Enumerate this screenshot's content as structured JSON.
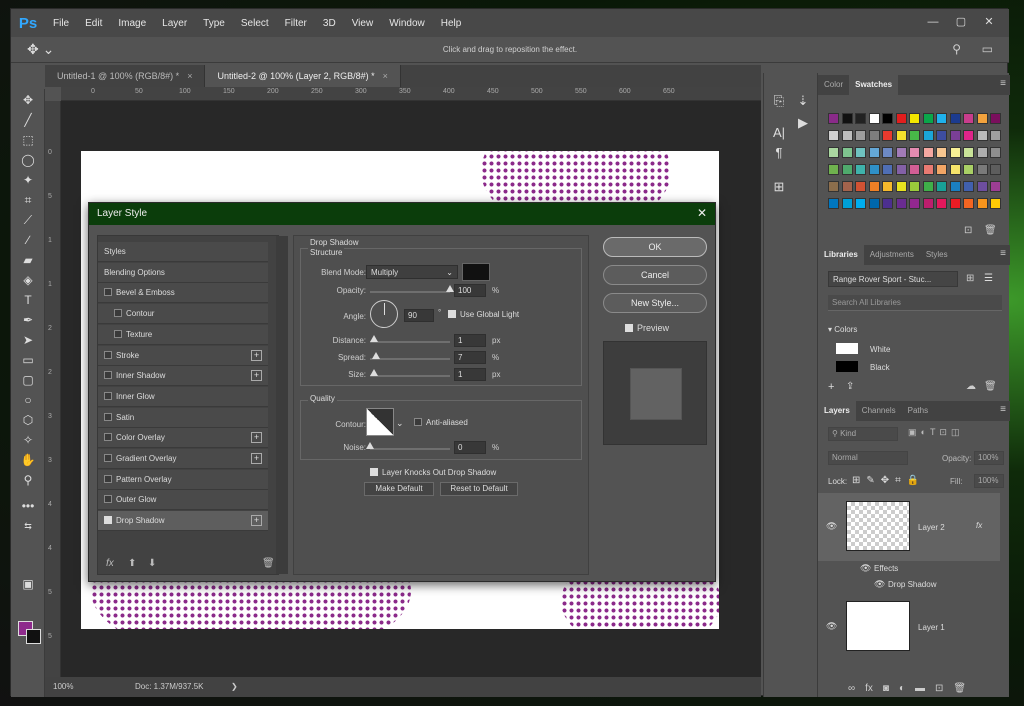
{
  "app": {
    "logo": "Ps",
    "menu": [
      "File",
      "Edit",
      "Image",
      "Layer",
      "Type",
      "Select",
      "Filter",
      "3D",
      "View",
      "Window",
      "Help"
    ],
    "window_controls": {
      "minimize": "—",
      "maximize": "▢",
      "close": "✕"
    }
  },
  "options_bar": {
    "hint": "Click and drag to reposition the effect."
  },
  "tabs": [
    {
      "label": "Untitled-1 @ 100% (RGB/8#) *",
      "close": "×"
    },
    {
      "label": "Untitled-2 @ 100% (Layer 2, RGB/8#) *",
      "close": "×"
    }
  ],
  "ruler_top": [
    "0",
    "50",
    "100",
    "150",
    "200",
    "250",
    "300",
    "350",
    "400",
    "450",
    "500",
    "550",
    "600",
    "650"
  ],
  "ruler_left": [
    "0",
    "5",
    "1",
    "1",
    "2",
    "2",
    "3",
    "3",
    "4",
    "4",
    "5",
    "5",
    "6"
  ],
  "status": {
    "zoom": "100%",
    "doc": "Doc: 1.37M/937.5K",
    "arrow": "❯"
  },
  "colors": {
    "foreground": "#8e2a8c",
    "background": "#111111",
    "dialog_title_bg": "#0b3d0b"
  },
  "right_panel": {
    "color_tabs": [
      "Color",
      "Swatches"
    ],
    "library_tabs": [
      "Libraries",
      "Adjustments",
      "Styles"
    ],
    "library_name": "Range Rover Sport - Stuc...",
    "library_search_placeholder": "Search All Libraries",
    "colors_section": "Colors",
    "color_items": [
      {
        "name": "White",
        "hex": "#ffffff"
      },
      {
        "name": "Black",
        "hex": "#000000"
      }
    ],
    "layer_tabs": [
      "Layers",
      "Channels",
      "Paths"
    ],
    "kind_placeholder": "Kind",
    "blend_mode": "Normal",
    "opacity_label": "Opacity:",
    "opacity_value": "100%",
    "lock_label": "Lock:",
    "fill_label": "Fill:",
    "fill_value": "100%",
    "layers": [
      {
        "name": "Layer 2",
        "fx": "fx"
      },
      {
        "name": "Layer 1"
      }
    ],
    "effects_label": "Effects",
    "effect_item": "Drop Shadow"
  },
  "dialog": {
    "title": "Layer Style",
    "close": "✕",
    "styles": [
      {
        "label": "Styles",
        "checkbox": false,
        "plus": false
      },
      {
        "label": "Blending Options",
        "checkbox": false,
        "plus": false
      },
      {
        "label": "Bevel & Emboss",
        "checkbox": true,
        "plus": false
      },
      {
        "label": "Contour",
        "checkbox": true,
        "plus": false,
        "indent": true
      },
      {
        "label": "Texture",
        "checkbox": true,
        "plus": false,
        "indent": true
      },
      {
        "label": "Stroke",
        "checkbox": true,
        "plus": true
      },
      {
        "label": "Inner Shadow",
        "checkbox": true,
        "plus": true
      },
      {
        "label": "Inner Glow",
        "checkbox": true,
        "plus": false
      },
      {
        "label": "Satin",
        "checkbox": true,
        "plus": false
      },
      {
        "label": "Color Overlay",
        "checkbox": true,
        "plus": true
      },
      {
        "label": "Gradient Overlay",
        "checkbox": true,
        "plus": true
      },
      {
        "label": "Pattern Overlay",
        "checkbox": true,
        "plus": false
      },
      {
        "label": "Outer Glow",
        "checkbox": true,
        "plus": false
      },
      {
        "label": "Drop Shadow",
        "checkbox": true,
        "checked": true,
        "plus": true,
        "active": true
      }
    ],
    "plus_symbol": "+",
    "fx_label": "fx",
    "drop_shadow_title": "Drop Shadow",
    "structure_title": "Structure",
    "blend_mode_label": "Blend Mode:",
    "blend_mode_value": "Multiply",
    "shadow_color": "#111111",
    "opacity_label": "Opacity:",
    "opacity_value": "100",
    "opacity_percent": 100,
    "angle_label": "Angle:",
    "angle_value": "90",
    "degree": "°",
    "use_global_light": "Use Global Light",
    "distance_label": "Distance:",
    "distance_value": "1",
    "spread_label": "Spread:",
    "spread_value": "7",
    "spread_percent": 7,
    "size_label": "Size:",
    "size_value": "1",
    "unit_px": "px",
    "unit_percent": "%",
    "quality_title": "Quality",
    "contour_label": "Contour:",
    "anti_aliased": "Anti-aliased",
    "noise_label": "Noise:",
    "noise_value": "0",
    "knocks_out": "Layer Knocks Out Drop Shadow",
    "make_default": "Make Default",
    "reset_default": "Reset to Default",
    "ok": "OK",
    "cancel": "Cancel",
    "new_style": "New Style...",
    "preview": "Preview"
  }
}
